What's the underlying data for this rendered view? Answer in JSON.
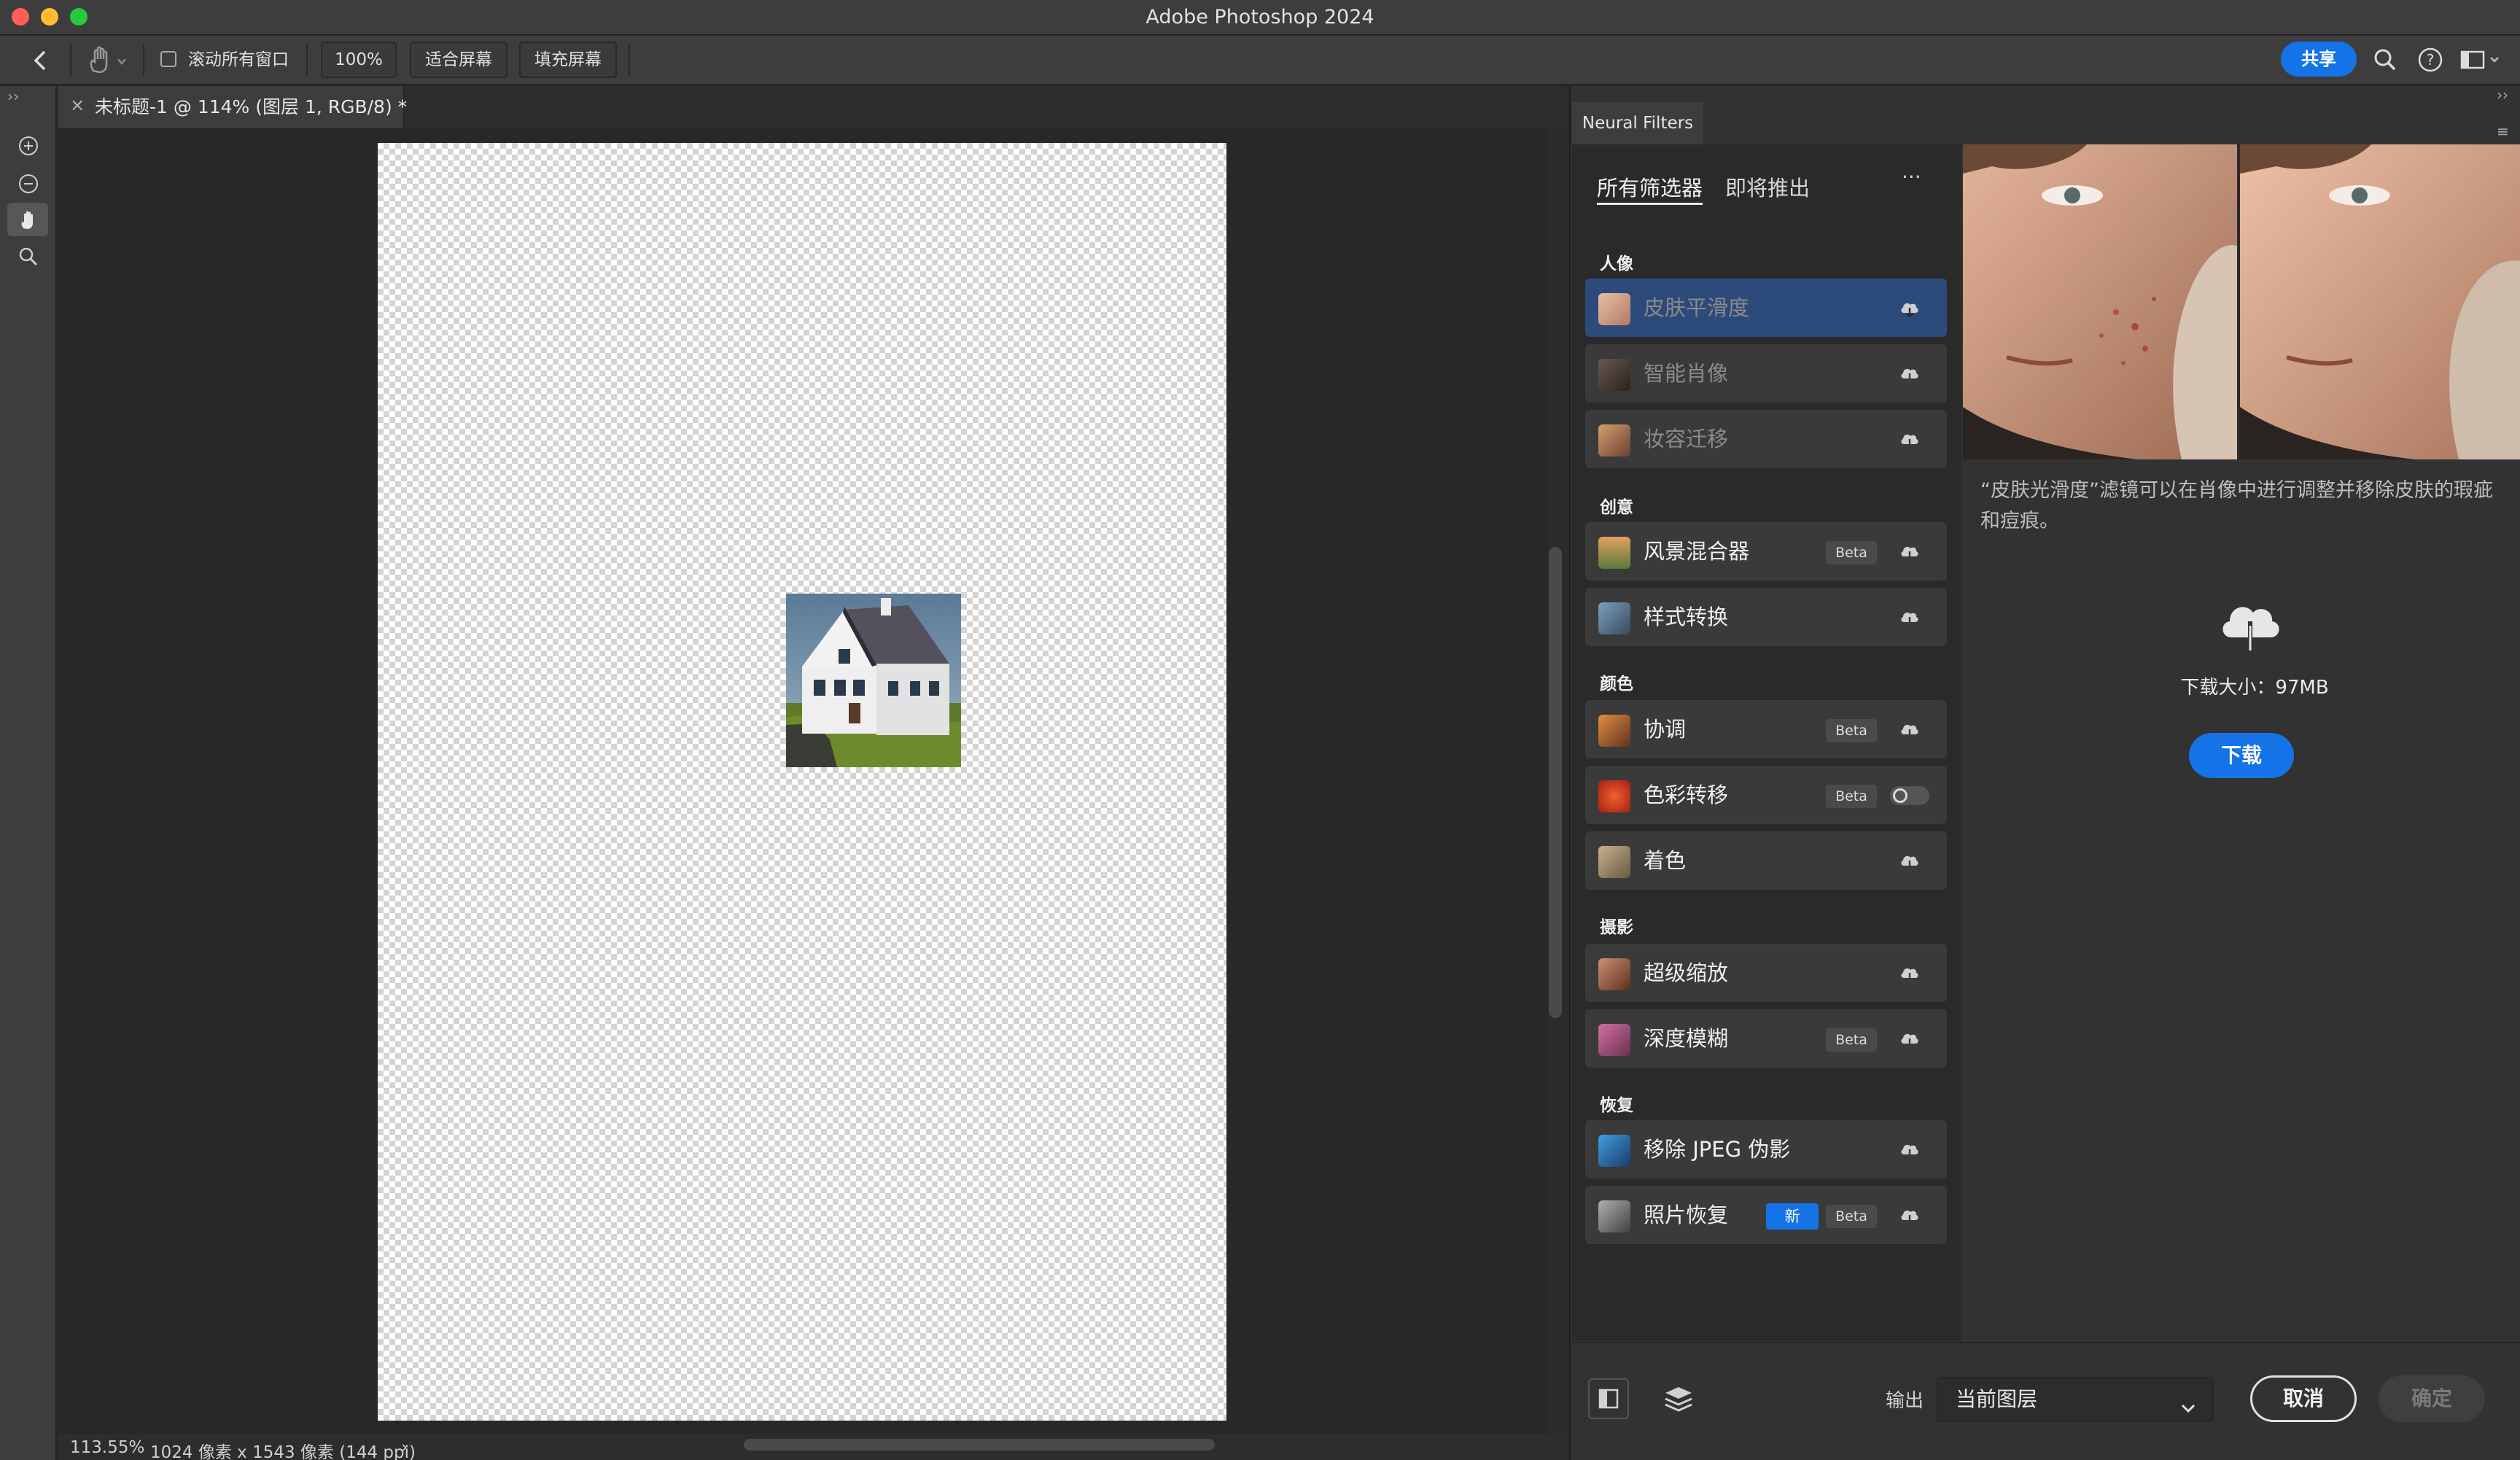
{
  "window": {
    "title": "Adobe Photoshop 2024"
  },
  "options_bar": {
    "scroll_all_label": "滚动所有窗口",
    "zoom_label": "100%",
    "fit_screen_label": "适合屏幕",
    "fill_screen_label": "填充屏幕",
    "share_label": "共享"
  },
  "document": {
    "tab_title": "未标题-1 @ 114% (图层 1, RGB/8) *",
    "tab_close": "×"
  },
  "status": {
    "zoom": "113.55%",
    "info": "1024 像素 x 1543 像素 (144 ppi)",
    "arrow": "›"
  },
  "neural_filters": {
    "panel_title": "Neural Filters",
    "tabs": [
      "所有筛选器",
      "即将推出"
    ],
    "more": "···",
    "categories": [
      {
        "label": "人像",
        "items": [
          {
            "name": "皮肤平滑度",
            "selected": true,
            "dim": true
          },
          {
            "name": "智能肖像",
            "dim": true
          },
          {
            "name": "妆容迁移",
            "dim": true
          }
        ]
      },
      {
        "label": "创意",
        "items": [
          {
            "name": "风景混合器",
            "beta": "Beta"
          },
          {
            "name": "样式转换"
          }
        ]
      },
      {
        "label": "颜色",
        "items": [
          {
            "name": "协调",
            "beta": "Beta"
          },
          {
            "name": "色彩转移",
            "beta": "Beta",
            "toggle": true
          },
          {
            "name": "着色"
          }
        ]
      },
      {
        "label": "摄影",
        "items": [
          {
            "name": "超级缩放"
          },
          {
            "name": "深度模糊",
            "beta": "Beta"
          }
        ]
      },
      {
        "label": "恢复",
        "items": [
          {
            "name": "移除 JPEG 伪影"
          },
          {
            "name": "照片恢复",
            "new": "新",
            "beta": "Beta"
          }
        ]
      }
    ],
    "description": "“皮肤光滑度”滤镜可以在肖像中进行调整并移除皮肤的瑕疵和痘痕。",
    "download_size": "下载大小：97MB",
    "download_label": "下载",
    "output_label": "输出",
    "output_value": "当前图层",
    "cancel_label": "取消",
    "ok_label": "确定"
  },
  "colors": {
    "accent": "#1473e6",
    "selected_row": "#2c4a7a"
  }
}
